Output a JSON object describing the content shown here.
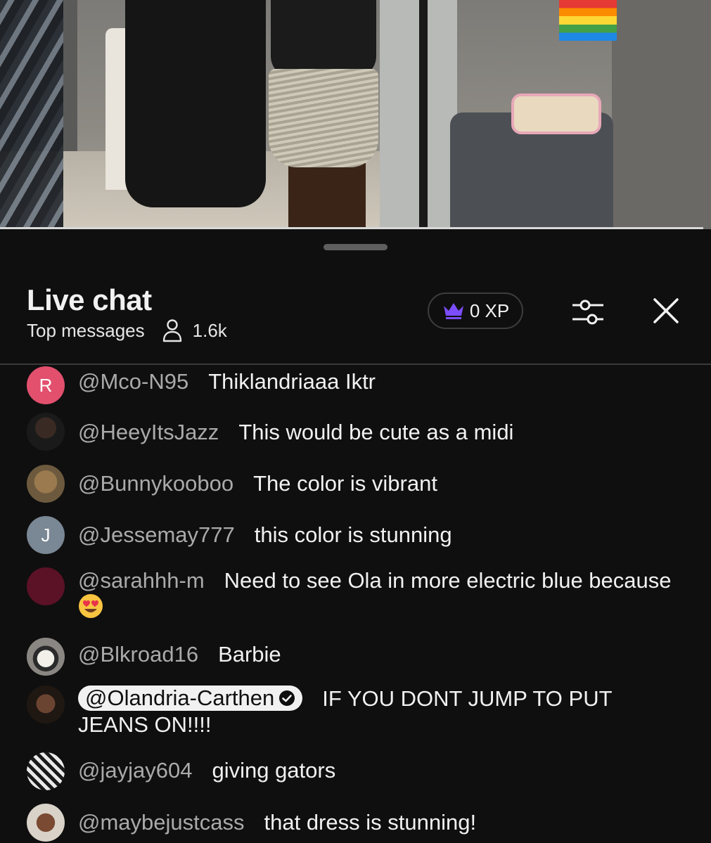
{
  "chat": {
    "title": "Live chat",
    "mode": "Top messages",
    "viewer_count": "1.6k",
    "xp_label": "0 XP"
  },
  "messages": [
    {
      "author": "@Mco-N95",
      "text": "Thiklandriaaa Iktr",
      "avatar_letter": "R",
      "avatar_color": "#e2506e"
    },
    {
      "author": "@HeeyItsJazz",
      "text": "This would be cute as a midi"
    },
    {
      "author": "@Bunnykooboo",
      "text": "The color is vibrant"
    },
    {
      "author": "@Jessemay777",
      "text": "this color is stunning",
      "avatar_letter": "J",
      "avatar_color": "#7a8794"
    },
    {
      "author": "@sarahhh-m",
      "text": "Need to see Ola in more electric blue because",
      "avatar_color": "#5b1126"
    },
    {
      "author": "@Blkroad16",
      "text": "Barbie"
    },
    {
      "author": "@Olandria-Carthen",
      "text": "IF YOU DONT JUMP TO PUT JEANS ON!!!!",
      "owner": true
    },
    {
      "author": "@jayjay604",
      "text": "giving gators"
    },
    {
      "author": "@maybejustcass",
      "text": "that dress is stunning!"
    }
  ],
  "colors": {
    "background": "#0f0f0f",
    "author_text": "#aaaaaa",
    "message_text": "#f1f1f1",
    "crown_accent": "#7b4dff"
  }
}
